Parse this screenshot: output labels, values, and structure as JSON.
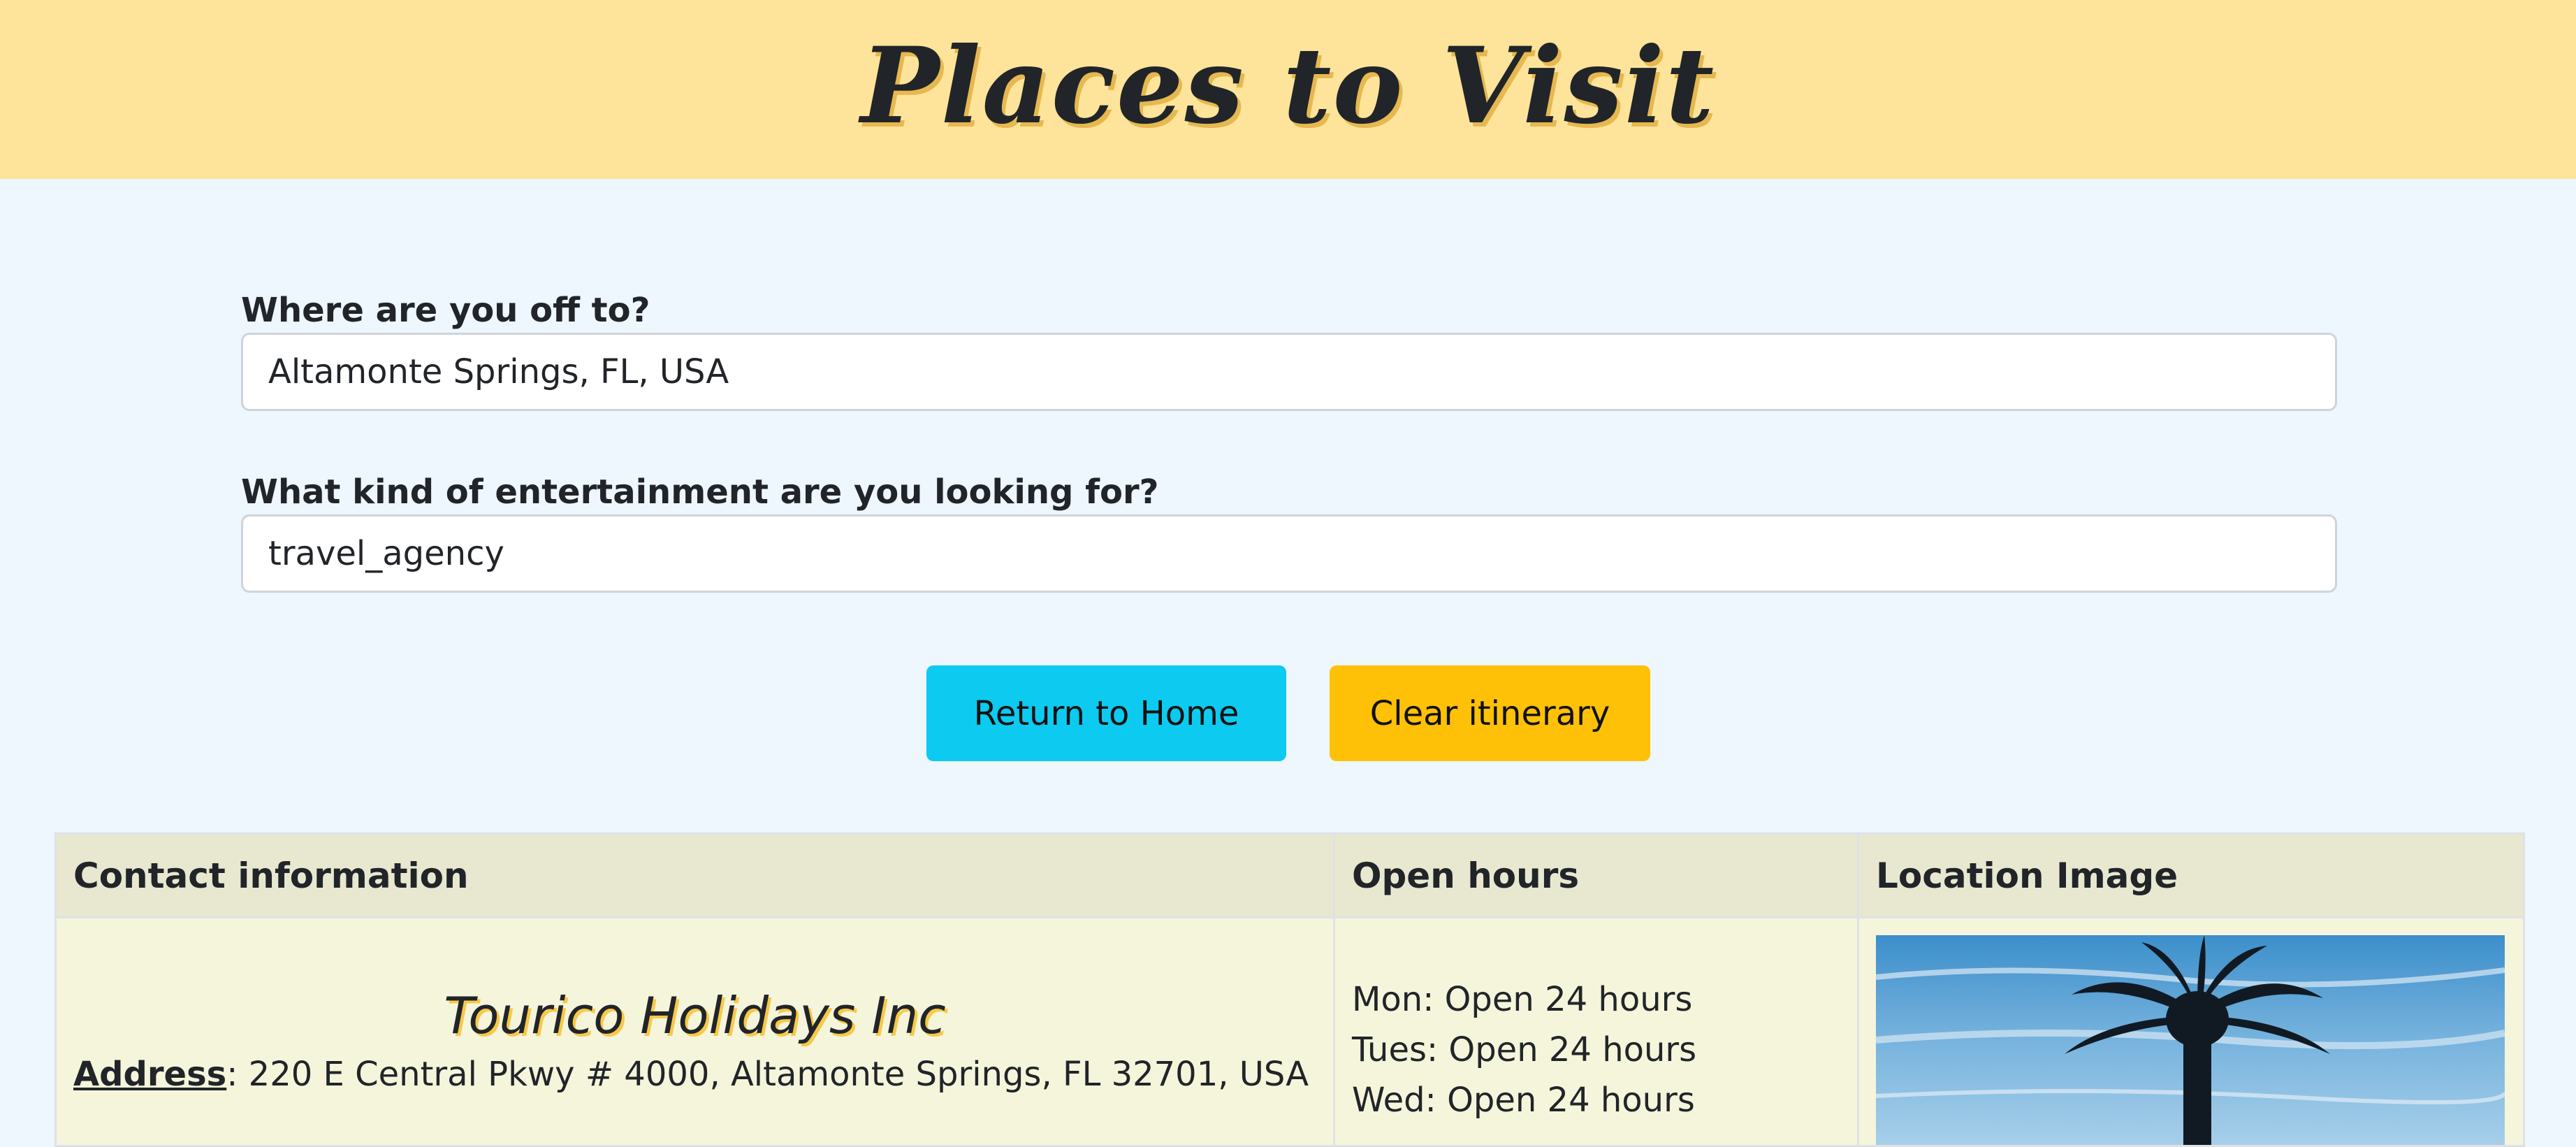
{
  "header": {
    "title": "Places to Visit"
  },
  "form": {
    "destination_label": "Where are you off to?",
    "destination_value": "Altamonte Springs, FL, USA",
    "entertainment_label": "What kind of entertainment are you looking for?",
    "entertainment_value": "travel_agency"
  },
  "buttons": {
    "home_label": "Return to Home",
    "clear_label": "Clear itinerary"
  },
  "colors": {
    "header_bg": "#fee49a",
    "page_bg": "#eef6fe",
    "home_button": "#0dcaf0",
    "clear_button": "#ffc107",
    "table_header_bg": "#e8e8d0",
    "table_cell_bg": "#f5f5dc"
  },
  "table": {
    "headers": [
      "Contact information",
      "Open hours",
      "Location Image"
    ],
    "rows": [
      {
        "name": "Tourico Holidays Inc",
        "address_label": "Address",
        "address_value": ": 220 E Central Pkwy # 4000, Altamonte Springs, FL 32701, USA",
        "hours": [
          "Mon: Open 24 hours",
          "Tues: Open 24 hours",
          "Wed: Open 24 hours"
        ],
        "image_icon": "palm-tree-sky-photo"
      }
    ]
  }
}
